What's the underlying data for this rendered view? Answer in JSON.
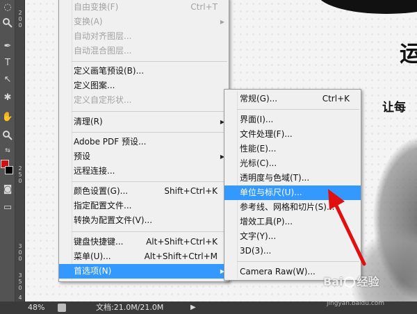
{
  "canvas": {
    "text_large": "运",
    "text_small": "让每"
  },
  "ruler": {
    "ticks": [
      "2",
      "0",
      "0",
      "2",
      "5",
      "0",
      "3",
      "0",
      "0",
      "3",
      "5",
      "0",
      "4"
    ]
  },
  "status_bar": {
    "zoom": "48%",
    "doc_info": "文档:21.0M/21.0M",
    "arrow": "▶"
  },
  "edit_menu": {
    "items": [
      {
        "label": "自由变换(F)",
        "shortcut": "Ctrl+T",
        "disabled": true
      },
      {
        "label": "变换(A)",
        "shortcut": "",
        "disabled": true,
        "submenu": true
      },
      {
        "label": "自动对齐图层...",
        "shortcut": "",
        "disabled": true
      },
      {
        "label": "自动混合图层...",
        "shortcut": "",
        "disabled": true
      },
      {
        "label": "定义画笔预设(B)...",
        "shortcut": "",
        "disabled": false
      },
      {
        "label": "定义图案...",
        "shortcut": "",
        "disabled": false
      },
      {
        "label": "定义自定形状...",
        "shortcut": "",
        "disabled": true
      },
      {
        "label": "清理(R)",
        "shortcut": "",
        "disabled": false,
        "submenu": true
      },
      {
        "label": "Adobe PDF 预设...",
        "shortcut": "",
        "disabled": false
      },
      {
        "label": "预设",
        "shortcut": "",
        "disabled": false,
        "submenu": true
      },
      {
        "label": "远程连接...",
        "shortcut": "",
        "disabled": false
      },
      {
        "label": "颜色设置(G)...",
        "shortcut": "Shift+Ctrl+K",
        "disabled": false
      },
      {
        "label": "指定配置文件...",
        "shortcut": "",
        "disabled": false
      },
      {
        "label": "转换为配置文件(V)...",
        "shortcut": "",
        "disabled": false
      },
      {
        "label": "键盘快捷键...",
        "shortcut": "Alt+Shift+Ctrl+K",
        "disabled": false
      },
      {
        "label": "菜单(U)...",
        "shortcut": "Alt+Shift+Ctrl+M",
        "disabled": false
      },
      {
        "label": "首选项(N)",
        "shortcut": "",
        "disabled": false,
        "submenu": true
      }
    ]
  },
  "preferences_submenu": {
    "items": [
      {
        "label": "常规(G)...",
        "shortcut": "Ctrl+K"
      },
      {
        "label": "界面(I)...",
        "shortcut": ""
      },
      {
        "label": "文件处理(F)...",
        "shortcut": ""
      },
      {
        "label": "性能(E)...",
        "shortcut": ""
      },
      {
        "label": "光标(C)...",
        "shortcut": ""
      },
      {
        "label": "透明度与色域(T)...",
        "shortcut": ""
      },
      {
        "label": "单位与标尺(U)...",
        "shortcut": "",
        "selected": true
      },
      {
        "label": "参考线、网格和切片(S)...",
        "shortcut": ""
      },
      {
        "label": "增效工具(P)...",
        "shortcut": ""
      },
      {
        "label": "文字(Y)...",
        "shortcut": ""
      },
      {
        "label": "3D(3)...",
        "shortcut": ""
      },
      {
        "label": "Camera Raw(W)...",
        "shortcut": ""
      }
    ]
  },
  "watermark": {
    "text_a": "Bai",
    "text_b": "经验",
    "url": "jingyan.baidu.com"
  },
  "colors": {
    "foreground": "#d20f10",
    "background": "#000000",
    "highlight": "#3399ff",
    "annotation_arrow": "#e01010"
  }
}
